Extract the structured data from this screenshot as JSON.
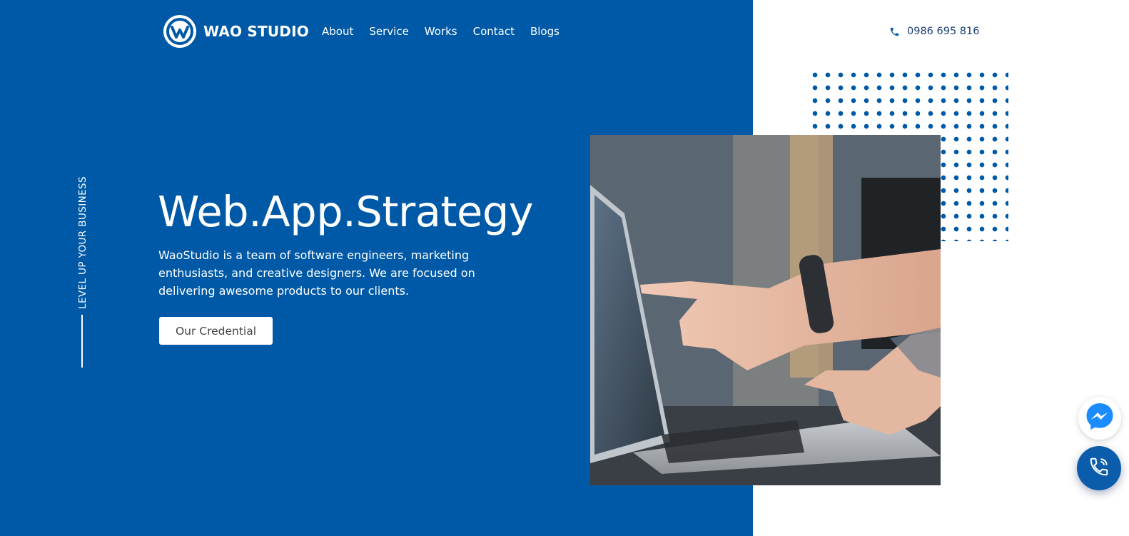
{
  "header": {
    "brand": "WAO STUDIO",
    "nav": [
      {
        "label": "About"
      },
      {
        "label": "Service"
      },
      {
        "label": "Works"
      },
      {
        "label": "Contact"
      },
      {
        "label": "Blogs"
      }
    ],
    "phone": "0986 695 816"
  },
  "hero": {
    "tagline": "LEVEL UP YOUR BUSINESS",
    "title": "Web.App.Strategy",
    "description": "WaoStudio is a team of software engineers, marketing enthusiasts, and creative designers. We are focused on delivering awesome products to our clients.",
    "cta_label": "Our Credential"
  },
  "icons": {
    "logo": "wao-logo-icon",
    "phone": "phone-icon",
    "messenger": "messenger-icon",
    "call": "call-icon"
  },
  "colors": {
    "primary": "#0059a6",
    "phone_text": "#1a3f73",
    "messenger": "#1a8cff",
    "background": "#ffffff"
  }
}
